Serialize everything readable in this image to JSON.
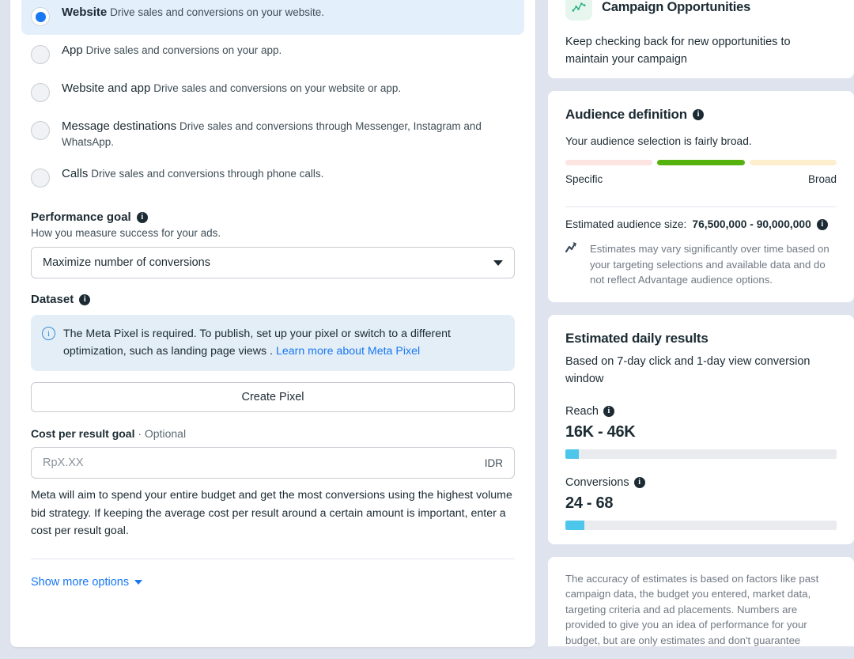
{
  "conversion_location": {
    "options": [
      {
        "title": "Website",
        "desc": "Drive sales and conversions on your website.",
        "selected": true
      },
      {
        "title": "App",
        "desc": "Drive sales and conversions on your app.",
        "selected": false
      },
      {
        "title": "Website and app",
        "desc": "Drive sales and conversions on your website or app.",
        "selected": false
      },
      {
        "title": "Message destinations",
        "desc": "Drive sales and conversions through Messenger, Instagram and WhatsApp.",
        "selected": false
      },
      {
        "title": "Calls",
        "desc": "Drive sales and conversions through phone calls.",
        "selected": false
      }
    ]
  },
  "performance_goal": {
    "heading": "Performance goal",
    "info_glyph": "i",
    "subtext": "How you measure success for your ads.",
    "selected_option": "Maximize number of conversions",
    "caret_icon": "chevron-down-icon"
  },
  "dataset": {
    "heading": "Dataset",
    "info_glyph": "i",
    "notice_icon": "i",
    "notice_text": "The Meta Pixel is required. To publish, set up your pixel or switch to a different optimization, such as landing page views . ",
    "notice_link": "Learn more about Meta Pixel",
    "create_pixel_label": "Create Pixel"
  },
  "cost_per_result": {
    "label": "Cost per result goal",
    "optional_suffix": " · Optional",
    "input_value": "",
    "input_placeholder": "RpX.XX",
    "currency": "IDR",
    "helper": "Meta will aim to spend your entire budget and get the most conversions using the highest volume bid strategy. If keeping the average cost per result around a certain amount is important, enter a cost per result goal."
  },
  "show_more": {
    "label": "Show more options",
    "caret_icon": "chevron-down-icon"
  },
  "campaign_opportunities": {
    "icon": "line-chart-icon",
    "icon_bg": "#e6f6ef",
    "icon_color": "#31b588",
    "title": "Campaign Opportunities",
    "body": "Keep checking back for new opportunities to maintain your campaign"
  },
  "audience_definition": {
    "title": "Audience definition",
    "info_glyph": "i",
    "subtitle": "Your audience selection is fairly broad.",
    "meter": {
      "segments": [
        {
          "name": "specific",
          "color": "#fbe4e2",
          "active": false
        },
        {
          "name": "balanced",
          "color": "#55b10b",
          "active": true
        },
        {
          "name": "broad",
          "color": "#fdeecd",
          "active": false
        }
      ],
      "left_label": "Specific",
      "right_label": "Broad"
    },
    "size_label": "Estimated audience size:",
    "size_value": "76,500,000 - 90,000,000",
    "size_info_glyph": "i",
    "estimate_icon": "trend-line-icon",
    "estimate_note": "Estimates may vary significantly over time based on your targeting selections and available data and do not reflect Advantage audience options."
  },
  "estimated_daily_results": {
    "title": "Estimated daily results",
    "subtitle": "Based on 7-day click and 1-day view conversion window",
    "metrics": [
      {
        "label": "Reach",
        "info_glyph": "i",
        "value": "16K - 46K",
        "bar_percent": 5
      },
      {
        "label": "Conversions",
        "info_glyph": "i",
        "value": "24 - 68",
        "bar_percent": 7
      }
    ],
    "bar_fill_color": "#4dc6eb",
    "bar_track_color": "#e9ebee"
  },
  "footer_disclaimer": {
    "text": "The accuracy of estimates is based on factors like past campaign data, the budget you entered, market data, targeting criteria and ad placements. Numbers are provided to give you an idea of performance for your budget, but are only estimates and don't guarantee results."
  }
}
